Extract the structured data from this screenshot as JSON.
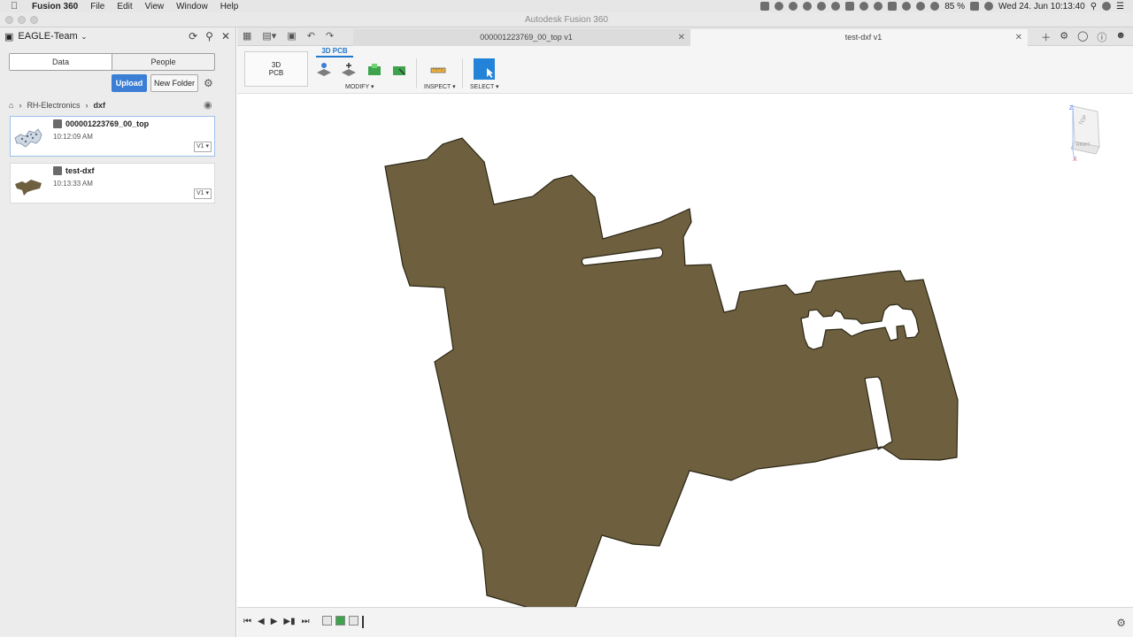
{
  "menubar": {
    "app_name": "Fusion 360",
    "items": [
      "File",
      "Edit",
      "View",
      "Window",
      "Help"
    ],
    "battery": "85 %",
    "datetime": "Wed 24. Jun  10:13:40"
  },
  "window": {
    "title": "Autodesk Fusion 360"
  },
  "data_panel": {
    "team": "EAGLE-Team",
    "tabs": [
      "Data",
      "People"
    ],
    "upload_label": "Upload",
    "new_folder_label": "New Folder",
    "breadcrumb": [
      "RH-Electronics",
      "dxf"
    ],
    "files": [
      {
        "name": "000001223769_00_top",
        "time": "10:12:09 AM",
        "version": "V1 ▾"
      },
      {
        "name": "test-dxf",
        "time": "10:13:33 AM",
        "version": "V1 ▾"
      }
    ]
  },
  "doc_tabs": [
    {
      "title": "000001223769_00_top v1"
    },
    {
      "title": "test-dxf v1"
    }
  ],
  "toolbar": {
    "workspace_line1": "3D",
    "workspace_line2": "PCB",
    "active_tab": "3D PCB",
    "groups": [
      "MODIFY ▾",
      "INSPECT ▾",
      "SELECT ▾"
    ]
  },
  "viewcube": {
    "top": "TOP",
    "right": "RIGHT",
    "axis_z": "Z",
    "axis_x": "X"
  },
  "colors": {
    "board_fill": "#6e603f",
    "accent": "#2277cc",
    "upload_button": "#3b7ed6"
  },
  "icons": [
    "apple-icon",
    "grid-icon",
    "refresh-icon",
    "search-icon",
    "close-icon",
    "gear-icon",
    "home-icon",
    "globe-icon",
    "play-icon"
  ]
}
